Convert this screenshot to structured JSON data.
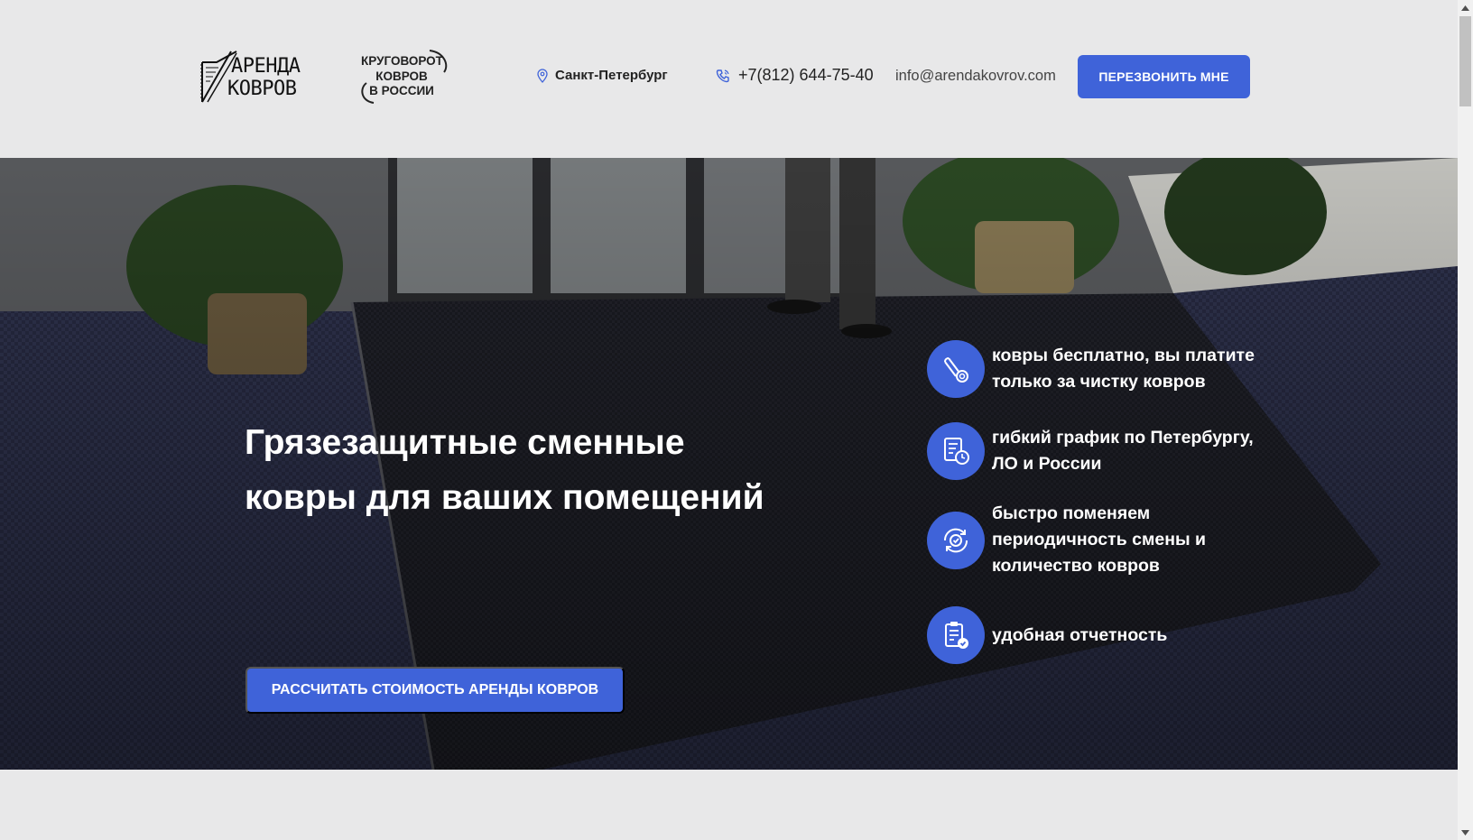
{
  "header": {
    "logo": {
      "line1": "АРЕНДА",
      "line2": "КОВРОВ",
      "icon": "carpet-logo-icon"
    },
    "slogan": {
      "lines": [
        "КРУГОВОРОТ",
        "КОВРОВ",
        "В РОССИИ"
      ]
    },
    "city": {
      "label": "Санкт-Петербург",
      "icon": "location-pin-icon"
    },
    "phone": {
      "label": "+7(812) 644-75-40",
      "icon": "phone-icon"
    },
    "email": "info@arendakovrov.com",
    "callback_button": "ПЕРЕЗВОНИТЬ МНЕ"
  },
  "hero": {
    "title_line1": "Грязезащитные сменные",
    "title_line2": "ковры для ваших помещений",
    "calc_button": "РАССЧИТАТЬ СТОИМОСТЬ АРЕНДЫ КОВРОВ",
    "features": [
      {
        "icon": "carpet-roll-icon",
        "text": "ковры бесплатно, вы платите только за чистку ковров"
      },
      {
        "icon": "schedule-clock-icon",
        "text": "гибкий график по Петербургу, ЛО и России"
      },
      {
        "icon": "refresh-gear-icon",
        "text": "быстро поменяем периодичность смены и количество ковров"
      },
      {
        "icon": "clipboard-check-icon",
        "text": "удобная отчетность"
      }
    ]
  },
  "colors": {
    "accent": "#3f63d9",
    "background": "#e8e8e9",
    "hero_dark": "#1f2233"
  }
}
